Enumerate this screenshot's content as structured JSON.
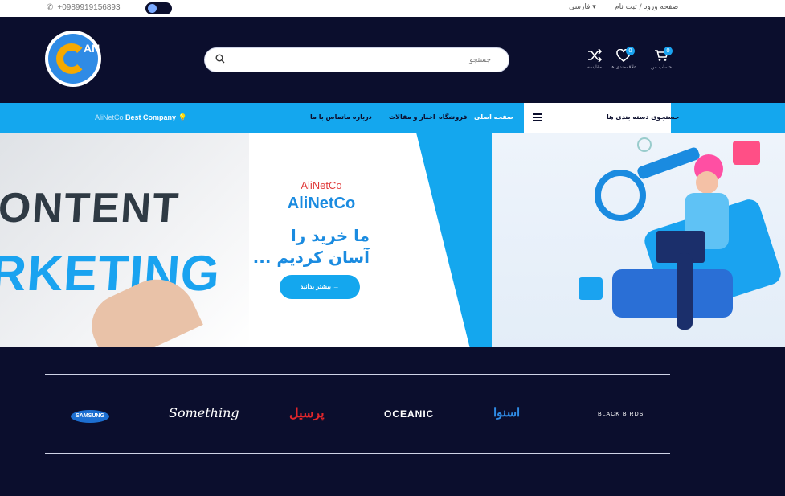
{
  "topbar": {
    "phone": "+0989919156893",
    "language": "فارسی ▾",
    "login": "صفحه ورود / ثبت نام"
  },
  "header": {
    "logo_text": "AN",
    "search_placeholder": "جستجو",
    "icons": [
      {
        "name": "cart",
        "caption": "حساب من",
        "badge": "0"
      },
      {
        "name": "wishlist",
        "caption": "علاقه‌مندی ها",
        "badge": "0"
      },
      {
        "name": "compare",
        "caption": "مقایسه"
      }
    ]
  },
  "nav": {
    "tagline_brand": "AliNetCo",
    "tagline_rest": " Best Company",
    "items": [
      "صفحه اصلی",
      "فروشگاه",
      "اخبار و مقالات",
      "درباره ما",
      "تماس با ما"
    ],
    "categories": "جستجوی دسته بندی ها"
  },
  "hero": {
    "img_word1": "ONTENT",
    "img_word2": "RKETING",
    "small_title": "AliNetCo",
    "title": "AliNetCo",
    "headline": "ما خرید را آسان کردیم ...",
    "cta": "بیشتر بدانید  →"
  },
  "brands": [
    "SAMSUNG",
    "Something",
    "پرسیل",
    "OCEANIC",
    "اسنوا",
    "BLACK BIRDS"
  ],
  "colors": {
    "navy": "#0b0e2d",
    "accent": "#14a7ee",
    "red": "#e03a3a"
  }
}
